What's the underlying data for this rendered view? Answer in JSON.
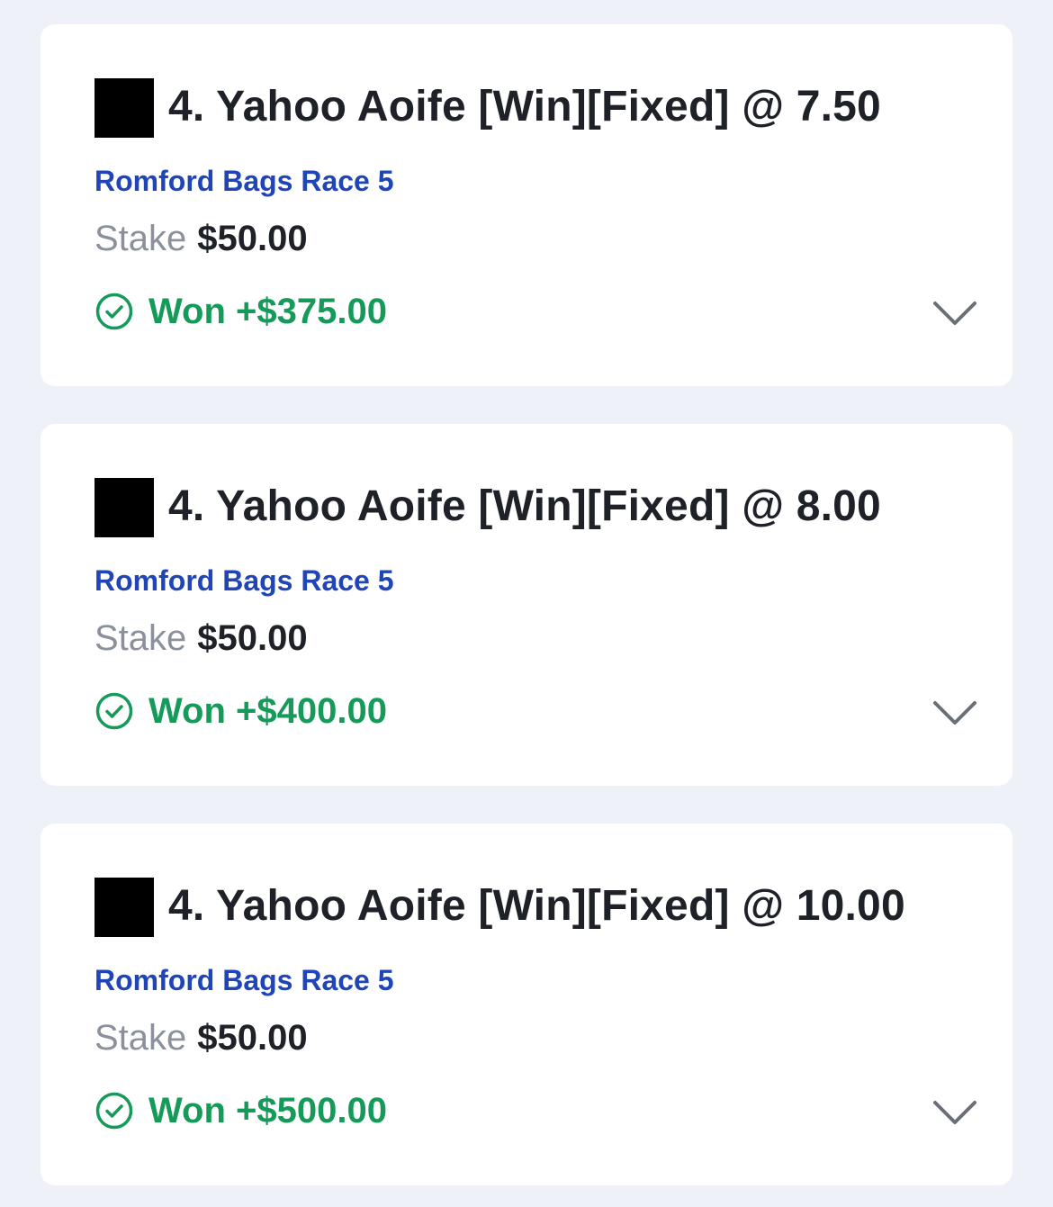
{
  "bets": [
    {
      "selection": "4. Yahoo Aoife [Win][Fixed] @ 7.50",
      "race": "Romford Bags Race 5",
      "stake_label": "Stake",
      "stake_value": "$50.00",
      "result": "Won +$375.00",
      "silk_icon": "black-square-silk",
      "status_icon": "check-circle-icon",
      "expand_icon": "chevron-down-icon"
    },
    {
      "selection": "4. Yahoo Aoife [Win][Fixed] @ 8.00",
      "race": "Romford Bags Race 5",
      "stake_label": "Stake",
      "stake_value": "$50.00",
      "result": "Won +$400.00",
      "silk_icon": "black-square-silk",
      "status_icon": "check-circle-icon",
      "expand_icon": "chevron-down-icon"
    },
    {
      "selection": "4. Yahoo Aoife [Win][Fixed] @ 10.00",
      "race": "Romford Bags Race 5",
      "stake_label": "Stake",
      "stake_value": "$50.00",
      "result": "Won +$500.00",
      "silk_icon": "black-square-silk",
      "status_icon": "check-circle-icon",
      "expand_icon": "chevron-down-icon"
    }
  ],
  "colors": {
    "background": "#eef1f8",
    "card": "#ffffff",
    "title_text": "#1f2128",
    "race_link": "#1f45b8",
    "stake_label": "#8a909c",
    "won_green": "#169a5a",
    "chevron": "#6b6f78"
  }
}
